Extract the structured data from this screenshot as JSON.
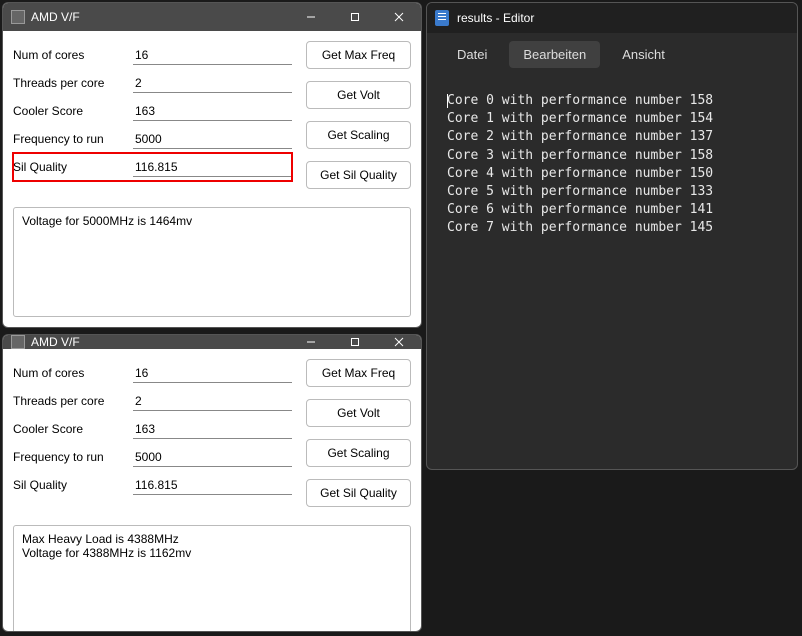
{
  "amd_windows": [
    {
      "title": "AMD V/F",
      "fields": [
        {
          "label": "Num of cores",
          "value": "16",
          "highlight": false
        },
        {
          "label": "Threads per core",
          "value": "2",
          "highlight": false
        },
        {
          "label": "Cooler Score",
          "value": "163",
          "highlight": false
        },
        {
          "label": "Frequency to run",
          "value": "5000",
          "highlight": false
        },
        {
          "label": "Sil Quality",
          "value": "116.815",
          "highlight": true
        }
      ],
      "buttons": [
        "Get Max Freq",
        "Get Volt",
        "Get Scaling",
        "Get Sil Quality"
      ],
      "output": "Voltage for 5000MHz is 1464mv"
    },
    {
      "title": "AMD V/F",
      "fields": [
        {
          "label": "Num of cores",
          "value": "16",
          "highlight": false
        },
        {
          "label": "Threads per core",
          "value": "2",
          "highlight": false
        },
        {
          "label": "Cooler Score",
          "value": "163",
          "highlight": false
        },
        {
          "label": "Frequency to run",
          "value": "5000",
          "highlight": false
        },
        {
          "label": "Sil Quality",
          "value": "116.815",
          "highlight": false
        }
      ],
      "buttons": [
        "Get Max Freq",
        "Get Volt",
        "Get Scaling",
        "Get Sil Quality"
      ],
      "output": "Max Heavy Load is 4388MHz\nVoltage for 4388MHz is 1162mv"
    }
  ],
  "editor": {
    "title": "results - Editor",
    "menu": [
      "Datei",
      "Bearbeiten",
      "Ansicht"
    ],
    "menu_active_index": 1,
    "lines": [
      "Core 0 with performance number 158",
      "Core 1 with performance number 154",
      "Core 2 with performance number 137",
      "Core 3 with performance number 158",
      "Core 4 with performance number 150",
      "Core 5 with performance number 133",
      "Core 6 with performance number 141",
      "Core 7 with performance number 145"
    ]
  },
  "chart_data": {
    "type": "table",
    "title": "Core performance numbers",
    "columns": [
      "Core",
      "Performance number"
    ],
    "rows": [
      [
        0,
        158
      ],
      [
        1,
        154
      ],
      [
        2,
        137
      ],
      [
        3,
        158
      ],
      [
        4,
        150
      ],
      [
        5,
        133
      ],
      [
        6,
        141
      ],
      [
        7,
        145
      ]
    ]
  }
}
